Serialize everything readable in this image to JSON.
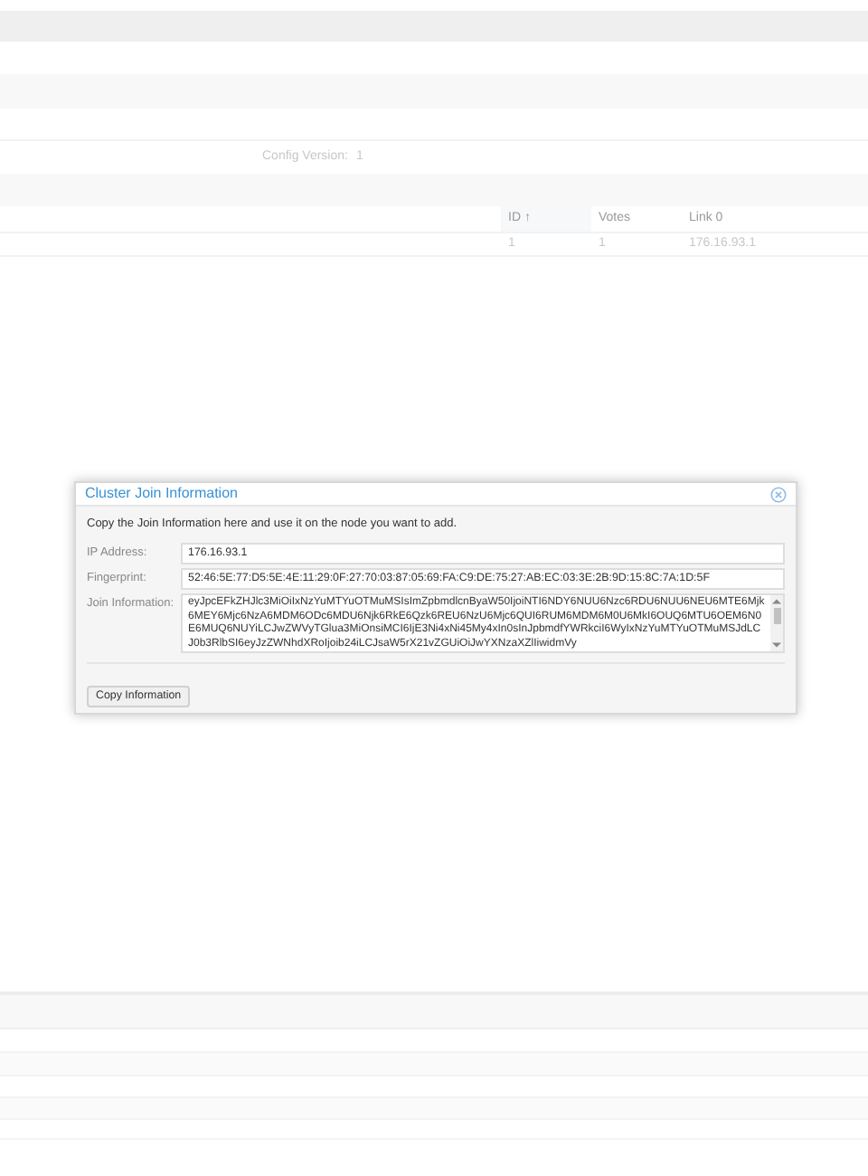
{
  "config": {
    "label": "Config Version:",
    "value": "1"
  },
  "table": {
    "columns": [
      {
        "label": "ID",
        "sort_arrow": "↑"
      },
      {
        "label": "Votes"
      },
      {
        "label": "Link 0"
      }
    ],
    "rows": [
      [
        "1",
        "1",
        "176.16.93.1"
      ]
    ]
  },
  "dialog": {
    "title": "Cluster Join Information",
    "intro": "Copy the Join Information here and use it on the node you want to add.",
    "fields": [
      {
        "kind": "input",
        "label": "IP Address:",
        "value": "176.16.93.1"
      },
      {
        "kind": "input",
        "label": "Fingerprint:",
        "value": "52:46:5E:77:D5:5E:4E:11:29:0F:27:70:03:87:05:69:FA:C9:DE:75:27:AB:EC:03:3E:2B:9D:15:8C:7A:1D:5F"
      },
      {
        "kind": "textarea",
        "label": "Join Information:",
        "value": "eyJpcEFkZHJlc3MiOiIxNzYuMTYuOTMuMSIsImZpbmdlcnByaW50IjoiNTI6NDY6NUU6Nzc6RDU6NUU6NEU6MTE6Mjk6MEY6Mjc6NzA6MDM6ODc6MDU6Njk6RkE6Qzk6REU6NzU6Mjc6QUI6RUM6MDM6M0U6MkI6OUQ6MTU6OEM6N0E6MUQ6NUYiLCJwZWVyTGlua3MiOnsiMCI6IjE3Ni4xNi45My4xIn0sInJpbmdfYWRkciI6WyIxNzYuMTYuOTMuMSJdLCJ0b3RlbSI6eyJzZWNhdXRoIjoib24iLCJsaW5rX21vZGUiOiJwYXNzaXZlIiwidmVy"
      }
    ],
    "button": "Copy Information"
  }
}
